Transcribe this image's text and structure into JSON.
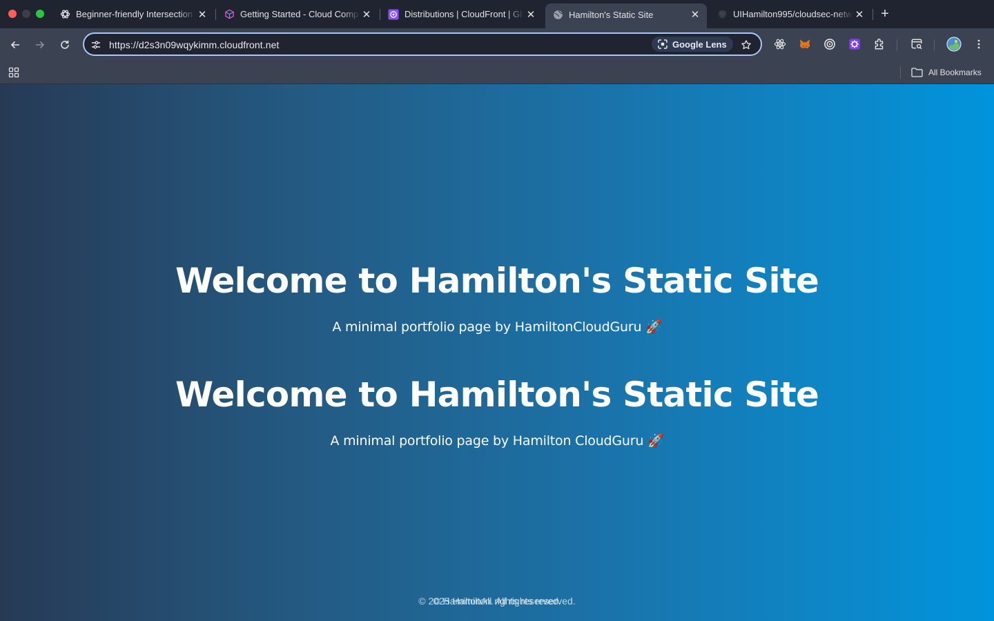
{
  "browser": {
    "tabs": [
      {
        "title": "Beginner-friendly Intersection",
        "icon": "chatgpt-icon"
      },
      {
        "title": "Getting Started - Cloud Comp",
        "icon": "cube-icon"
      },
      {
        "title": "Distributions | CloudFront | Gl",
        "icon": "cloudfront-icon"
      },
      {
        "title": "Hamilton's Static Site",
        "icon": "globe-icon",
        "active": true
      },
      {
        "title": "UIHamilton995/cloudsec-netw",
        "icon": "github-icon"
      }
    ],
    "close_glyph": "✕",
    "new_tab_glyph": "+",
    "url": "https://d2s3n09wqykimm.cloudfront.net",
    "lens_label": "Google Lens",
    "all_bookmarks_label": "All Bookmarks",
    "colors": {
      "chrome_bg": "#1f2430",
      "toolbar_bg": "#3b4252",
      "omnibox_border": "#a8c7fa"
    }
  },
  "page": {
    "sections": [
      {
        "heading": "Welcome to Hamilton's Static Site",
        "tagline": "A minimal portfolio page by HamiltonCloudGuru 🚀"
      },
      {
        "heading": "Welcome to Hamilton's Static Site",
        "tagline": "A minimal portfolio page by Hamilton CloudGuru 🚀"
      }
    ],
    "footer_lines": [
      "© 2025 Hamilton. All rights reserved.",
      "© HamiltonAll rights reserved."
    ],
    "colors": {
      "gradient_start": "#263a55",
      "gradient_end": "#0094dc",
      "text": "#ffffff"
    }
  }
}
